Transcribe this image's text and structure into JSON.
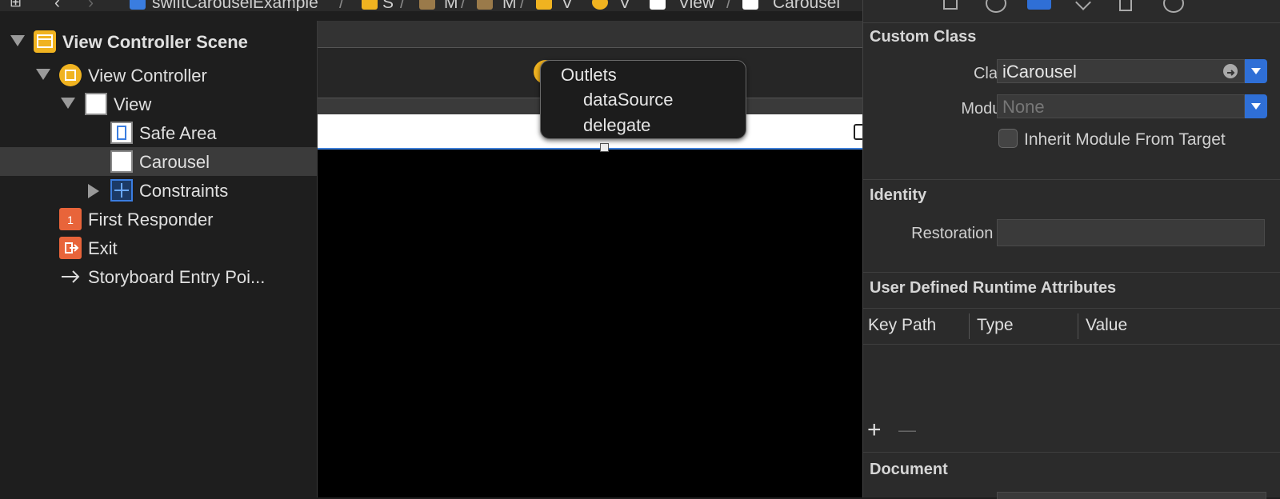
{
  "breadcrumb": {
    "project": "swiftCarouselExample",
    "items": [
      "S",
      "M",
      "M",
      "V",
      "V",
      "View",
      "Carousel"
    ]
  },
  "navigator": {
    "scene": "View Controller Scene",
    "view_controller": "View Controller",
    "view": "View",
    "safe_area": "Safe Area",
    "carousel": "Carousel",
    "constraints": "Constraints",
    "first_responder": "First Responder",
    "exit": "Exit",
    "entry_point": "Storyboard Entry Poi..."
  },
  "popover": {
    "title": "Outlets",
    "items": [
      "dataSource",
      "delegate"
    ]
  },
  "inspector": {
    "custom_class": {
      "header": "Custom Class",
      "class_label": "Class",
      "class_value": "iCarousel",
      "module_label": "Module",
      "module_placeholder": "None",
      "inherit_label": "Inherit Module From Target"
    },
    "identity": {
      "header": "Identity",
      "restoration_label": "Restoration ID",
      "restoration_value": ""
    },
    "runtime_attributes": {
      "header": "User Defined Runtime Attributes",
      "columns": [
        "Key Path",
        "Type",
        "Value"
      ],
      "add": "+",
      "remove": "—"
    },
    "document": {
      "header": "Document"
    }
  },
  "colors": {
    "accent": "#2f6fd6",
    "folder": "#f0b320",
    "exit": "#e8643a",
    "selection": "#3b3b3b"
  }
}
